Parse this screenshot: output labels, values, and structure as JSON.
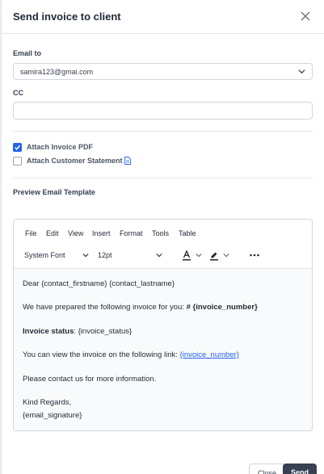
{
  "modal": {
    "title": "Send invoice to client",
    "close_icon": "close-icon"
  },
  "email_to": {
    "label": "Email to",
    "value": "samira123@gmai.com"
  },
  "cc": {
    "label": "CC",
    "value": ""
  },
  "attachments": {
    "invoice_pdf": {
      "label": "Attach Invoice PDF",
      "checked": true
    },
    "customer_statement": {
      "label": "Attach Customer Statement",
      "checked": false,
      "icon": "document-icon"
    }
  },
  "preview_label": "Preview Email Template",
  "editor": {
    "menu": [
      "File",
      "Edit",
      "View",
      "Insert",
      "Format",
      "Tools",
      "Table"
    ],
    "font_family": "System Font",
    "font_size": "12pt",
    "content": {
      "greeting": "Dear {contact_firstname} {contact_lastname}",
      "intro_text": "We have prepared the following invoice for you: ",
      "intro_bold": "# {invoice_number}",
      "status_label": "Invoice status",
      "status_value": ": {invoice_status}",
      "view_text": "You can view the invoice on the following link: ",
      "view_link": "{invoice_number}",
      "contact": "Please contact us for more information.",
      "regards": "Kind Regards,",
      "signature": "{email_signature}"
    }
  },
  "footer": {
    "close_label": "Close",
    "send_label": "Send"
  },
  "colors": {
    "accent": "#2563eb",
    "send_button": "#374151"
  }
}
